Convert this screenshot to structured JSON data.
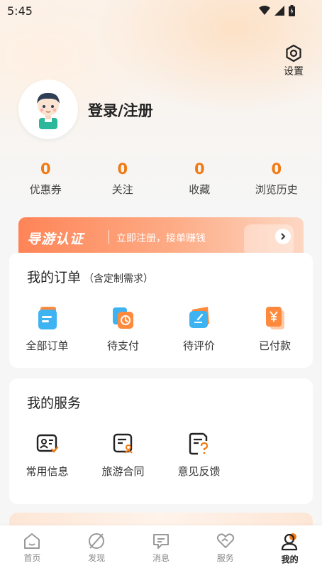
{
  "status_bar": {
    "time": "5:45"
  },
  "header": {
    "settings_label": "设置"
  },
  "profile": {
    "login_text": "登录/注册"
  },
  "stats": [
    {
      "value": "0",
      "label": "优惠券"
    },
    {
      "value": "0",
      "label": "关注"
    },
    {
      "value": "0",
      "label": "收藏"
    },
    {
      "value": "0",
      "label": "浏览历史"
    }
  ],
  "banner": {
    "title": "导游认证",
    "subtitle": "立即注册，接单赚钱"
  },
  "orders": {
    "title": "我的订单",
    "subtitle": "（含定制需求）",
    "items": [
      {
        "label": "全部订单",
        "icon": "all-orders-icon"
      },
      {
        "label": "待支付",
        "icon": "pending-payment-icon"
      },
      {
        "label": "待评价",
        "icon": "pending-review-icon"
      },
      {
        "label": "已付款",
        "icon": "paid-icon"
      }
    ]
  },
  "services": {
    "title": "我的服务",
    "items": [
      {
        "label": "常用信息",
        "icon": "contact-info-icon"
      },
      {
        "label": "旅游合同",
        "icon": "contract-icon"
      },
      {
        "label": "意见反馈",
        "icon": "feedback-icon"
      }
    ]
  },
  "tabbar": {
    "tabs": [
      {
        "label": "首页",
        "icon": "home-icon"
      },
      {
        "label": "发现",
        "icon": "discover-icon"
      },
      {
        "label": "消息",
        "icon": "message-icon"
      },
      {
        "label": "服务",
        "icon": "service-icon"
      },
      {
        "label": "我的",
        "icon": "profile-icon",
        "active": true
      }
    ]
  },
  "colors": {
    "accent": "#f07a14",
    "banner_start": "#fe8457",
    "banner_end": "#fdd7c3"
  }
}
